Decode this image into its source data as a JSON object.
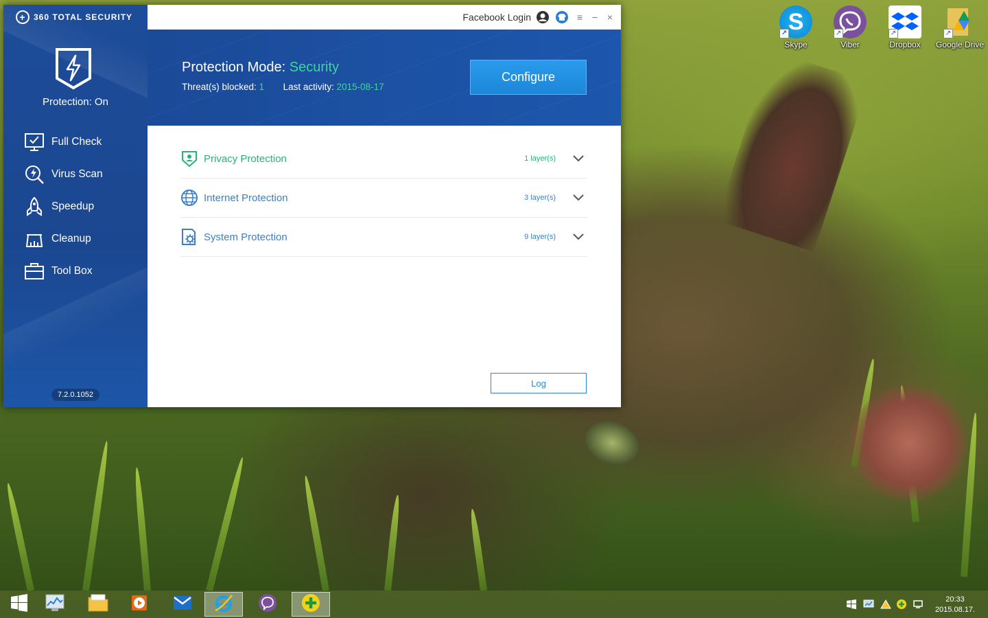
{
  "desktop": {
    "icons": [
      {
        "label": "Skype",
        "icon": "skype-icon",
        "color": "#0aa0e8"
      },
      {
        "label": "Viber",
        "icon": "viber-icon",
        "color": "#7b519d"
      },
      {
        "label": "Dropbox",
        "icon": "dropbox-icon",
        "color": "#0061fe"
      },
      {
        "label": "Google Drive",
        "icon": "google-drive-icon",
        "color": "#f4b400"
      }
    ]
  },
  "app": {
    "brand": "360 TOTAL SECURITY",
    "protection_status": "Protection: On",
    "version": "7.2.0.1052",
    "nav": [
      {
        "label": "Full Check",
        "icon": "full-check-icon"
      },
      {
        "label": "Virus Scan",
        "icon": "virus-scan-icon"
      },
      {
        "label": "Speedup",
        "icon": "speedup-icon"
      },
      {
        "label": "Cleanup",
        "icon": "cleanup-icon"
      },
      {
        "label": "Tool Box",
        "icon": "toolbox-icon"
      }
    ],
    "titlebar": {
      "facebook_login": "Facebook Login",
      "menu_glyph": "≡",
      "minimize_glyph": "−",
      "close_glyph": "×"
    },
    "banner": {
      "mode_label": "Protection Mode: ",
      "mode_value": "Security",
      "threats_label": "Threat(s) blocked: ",
      "threats_value": "1",
      "activity_label": "Last activity: ",
      "activity_value": "2015-08-17",
      "configure_label": "Configure"
    },
    "protections": [
      {
        "name": "Privacy Protection",
        "layers": "1 layer(s)",
        "icon": "privacy-shield-icon"
      },
      {
        "name": "Internet Protection",
        "layers": "3 layer(s)",
        "icon": "globe-icon"
      },
      {
        "name": "System Protection",
        "layers": "9 layer(s)",
        "icon": "system-gear-icon"
      }
    ],
    "log_label": "Log",
    "colors": {
      "accent_green": "#3fd49b",
      "sidebar_blue": "#1b4790",
      "link_blue": "#3d7fc6"
    }
  },
  "taskbar": {
    "apps": [
      "start-icon",
      "resource-monitor-icon",
      "file-explorer-icon",
      "media-player-icon",
      "mail-icon",
      "internet-explorer-icon",
      "viber-icon",
      "360-total-security-icon"
    ],
    "clock_time": "20:33",
    "clock_date": "2015.08.17."
  }
}
